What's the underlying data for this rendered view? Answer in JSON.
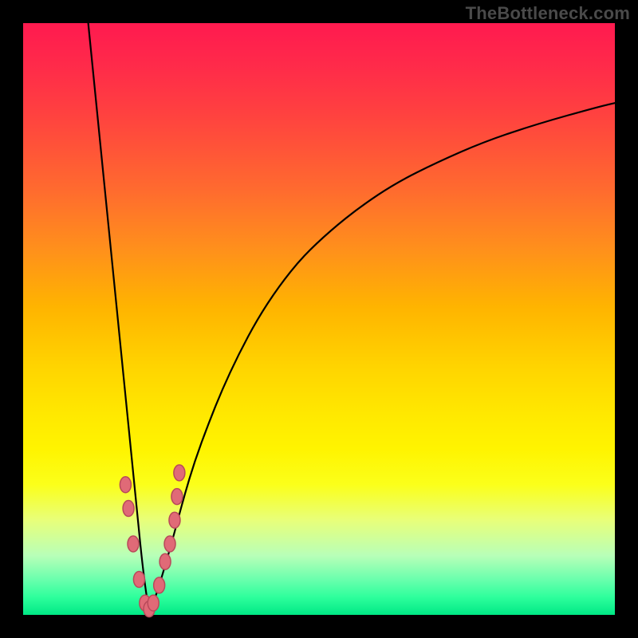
{
  "attribution": "TheBottleneck.com",
  "colors": {
    "frame": "#000000",
    "curve": "#000000",
    "marker_fill": "#e06a77",
    "marker_stroke": "#b8495a",
    "gradient_top": "#ff1a4f",
    "gradient_bottom": "#00e885"
  },
  "chart_data": {
    "type": "line",
    "title": "",
    "xlabel": "",
    "ylabel": "",
    "xlim": [
      0,
      100
    ],
    "ylim": [
      0,
      100
    ],
    "annotations": [
      "TheBottleneck.com"
    ],
    "note": "No axes/ticks shown; values estimated from pixel positions. y=100 at top, y=0 at bottom; x=0 left, x=100 right.",
    "series": [
      {
        "name": "curve-left",
        "x": [
          11.0,
          12.0,
          13.0,
          13.8,
          14.6,
          15.4,
          16.2,
          17.0,
          17.8,
          18.6,
          19.4,
          20.0,
          20.6,
          21.2
        ],
        "y": [
          100.0,
          90.0,
          80.0,
          72.0,
          64.0,
          56.0,
          48.0,
          40.0,
          32.0,
          24.0,
          16.0,
          10.0,
          5.0,
          1.0
        ]
      },
      {
        "name": "curve-right",
        "x": [
          21.2,
          22.0,
          23.0,
          24.2,
          25.6,
          27.2,
          29.0,
          31.2,
          33.6,
          36.4,
          39.6,
          43.2,
          47.2,
          52.0,
          57.0,
          63.0,
          70.0,
          78.0,
          87.0,
          97.0,
          100.0
        ],
        "y": [
          1.0,
          2.0,
          5.0,
          9.0,
          14.0,
          20.0,
          26.0,
          32.0,
          38.0,
          44.0,
          50.0,
          55.5,
          60.5,
          65.0,
          69.0,
          73.0,
          76.5,
          80.0,
          83.0,
          85.8,
          86.5
        ]
      }
    ],
    "markers": {
      "name": "data-points",
      "x": [
        17.3,
        17.8,
        18.6,
        19.6,
        20.6,
        21.3,
        22.0,
        23.0,
        24.0,
        24.8,
        25.6,
        26.0,
        26.4
      ],
      "y": [
        22.0,
        18.0,
        12.0,
        6.0,
        2.0,
        1.0,
        2.0,
        5.0,
        9.0,
        12.0,
        16.0,
        20.0,
        24.0
      ]
    }
  }
}
